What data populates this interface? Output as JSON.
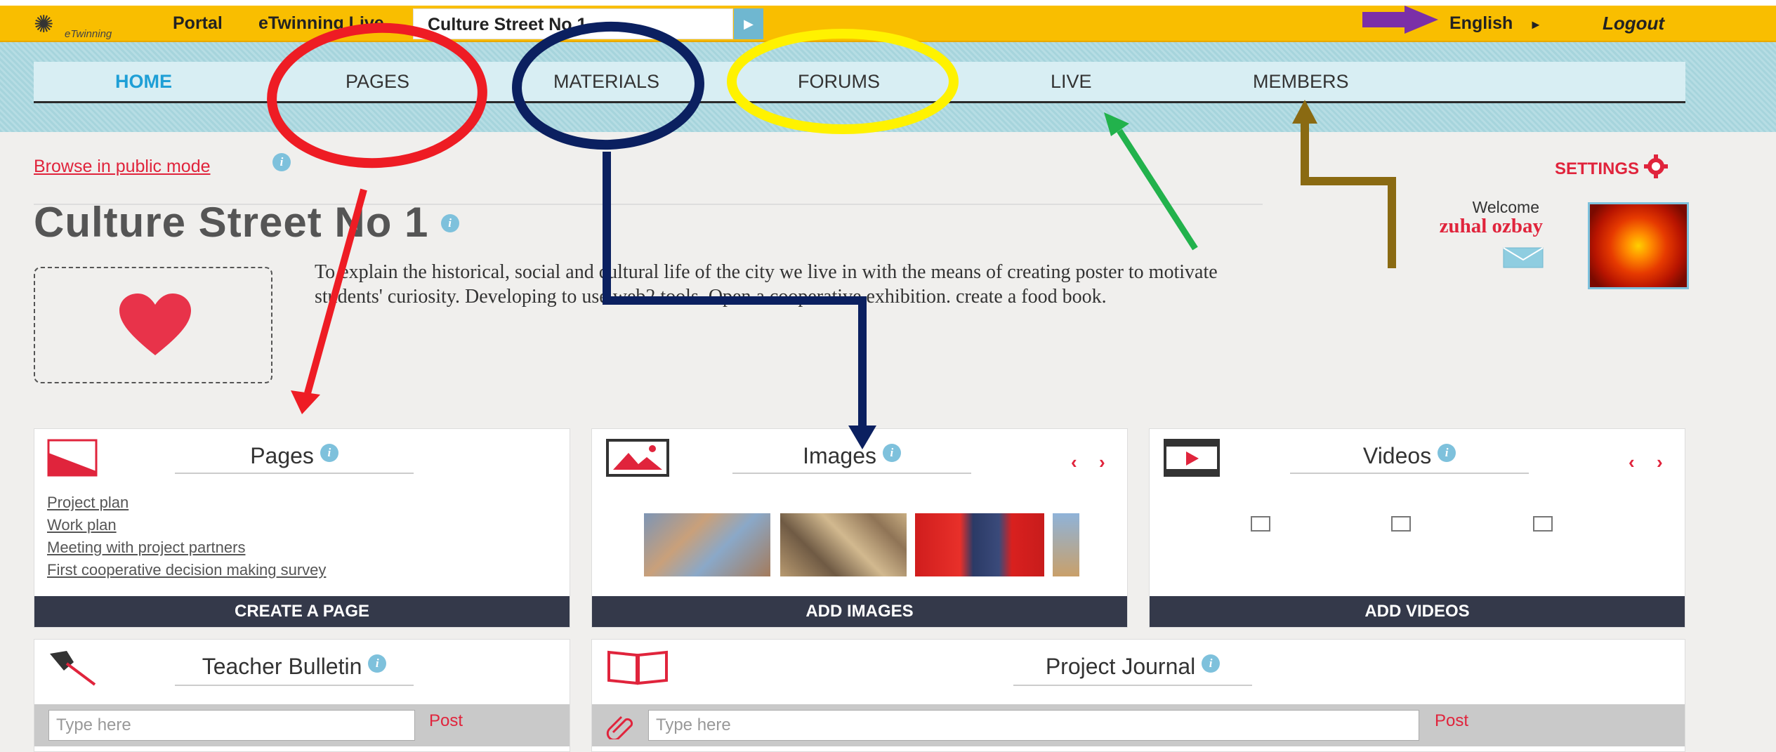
{
  "topbar": {
    "logo_text": "eTwinning",
    "links": [
      "Portal",
      "eTwinning Live"
    ],
    "project_name": "Culture Street No 1",
    "language": "English",
    "logout": "Logout"
  },
  "nav": {
    "items": [
      "HOME",
      "PAGES",
      "MATERIALS",
      "FORUMS",
      "LIVE",
      "MEMBERS"
    ],
    "active": "HOME"
  },
  "browse_public": "Browse in public mode",
  "settings": "SETTINGS",
  "project": {
    "title": "Culture Street No 1",
    "description": "To explain the historical, social and cultural life of the city we live in with the means of creating poster to motivate students' curiosity. Developing to use web2 tools. Open a cooperative exhibition. create a food book."
  },
  "user": {
    "welcome": "Welcome",
    "name": "zuhal ozbay"
  },
  "pages_card": {
    "title": "Pages",
    "links": [
      "Project plan",
      "Work plan",
      "Meeting with project partners",
      "First cooperative decision making survey"
    ],
    "button": "CREATE A PAGE"
  },
  "images_card": {
    "title": "Images",
    "button": "ADD IMAGES"
  },
  "videos_card": {
    "title": "Videos",
    "button": "ADD VIDEOS"
  },
  "bulletin_card": {
    "title": "Teacher Bulletin",
    "placeholder": "Type here",
    "post": "Post"
  },
  "journal_card": {
    "title": "Project Journal",
    "placeholder": "Type here",
    "post": "Post"
  },
  "colors": {
    "topbar": "#f9be00",
    "accent_red": "#e0243c",
    "accent_blue": "#1e9fd6",
    "button_dark": "#34394a",
    "annotation_red": "#ee1c24",
    "annotation_navy": "#0b2060",
    "annotation_yellow": "#fff200",
    "annotation_green": "#22b24c",
    "annotation_brown": "#8a6a12",
    "annotation_purple": "#7b2fa8"
  },
  "icons": [
    "etwinning-logo-icon",
    "info-icon",
    "gear-icon",
    "heart-icon",
    "mail-icon",
    "pages-icon",
    "image-icon",
    "video-icon",
    "pin-icon",
    "book-icon",
    "paperclip-icon"
  ]
}
